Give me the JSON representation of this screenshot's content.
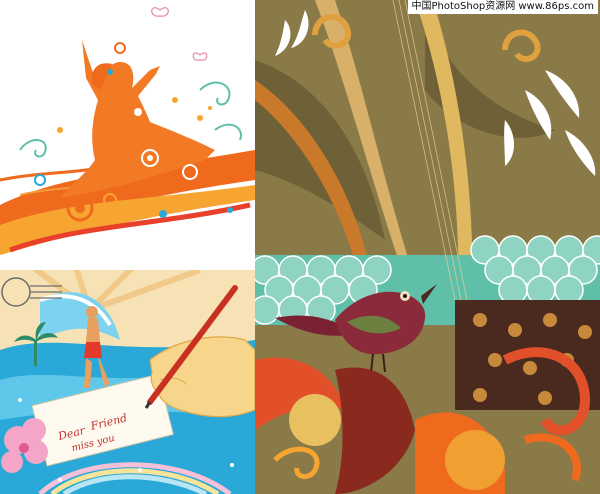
{
  "watermark": {
    "text": "中国PhotoShop资源网 www.86ps.com"
  },
  "handwriting": {
    "line1": "Dear",
    "line2": "Friend",
    "line3": "miss you"
  },
  "colors": {
    "orange": "#f06a1e",
    "olive": "#8a7a48",
    "teal": "#5fbfa8",
    "sea": "#2aa8d8",
    "bird": "#8a2a3a"
  },
  "scene": {
    "top_left": "dancing-woman-silhouette",
    "bottom_left": "surfer-and-writing-hand",
    "right": "bird-and-floral-ornaments"
  }
}
